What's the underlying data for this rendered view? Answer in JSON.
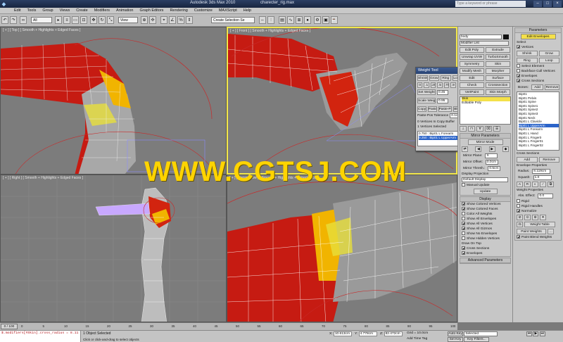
{
  "titlebar": {
    "app_title": "Autodesk 3ds Max 2010",
    "file_name": "charecter_rig.max",
    "search_placeholder": "Type a keyword or phrase"
  },
  "menu": [
    "Edit",
    "Tools",
    "Group",
    "Views",
    "Create",
    "Modifiers",
    "Animation",
    "Graph Editors",
    "Rendering",
    "Customize",
    "MAXScript",
    "Help"
  ],
  "toolbar": {
    "selection_filter": "All",
    "view_dropdown": "View",
    "selection_set": "Create Selection Se"
  },
  "viewports": {
    "top_label": "[ + ] [ Top ] [ Smooth + Highlights + Edged Faces ]",
    "front_label": "[ + ] [ Front ] [ Smooth + Highlights + Edged Faces ]",
    "right_label": "[ + ] [ Right ] [ Smooth + Highlights + Edged Faces ]",
    "persp_label": "[ + ] [ Perspective ] [ Smooth + Highlights + Edged Faces ]"
  },
  "watermark": "WWW.CGTSJ.COM",
  "weight_tool": {
    "title": "Weight Tool",
    "top_buttons": [
      "Shrink",
      "Grow",
      "Ring",
      "Loop"
    ],
    "preset_buttons": [
      "0",
      ".1",
      ".25",
      ".5",
      ".75",
      ".9",
      "1"
    ],
    "set_weight_label": "Set Weight",
    "set_weight_value": "0.45",
    "scale_weight_label": "Scale Weight",
    "scale_weight_value": "0.95",
    "copy_buttons": [
      "Copy",
      "Paste",
      "Paste-Pos",
      "Blend"
    ],
    "tolerance_label": "Paste-Pos Tolerance",
    "tolerance_value": "0.1cm",
    "copy_buffer_text": "0 Vertices In Copy Buffer",
    "selected_text": "1 Vertices Selected",
    "list_items": [
      "0.750 : Bip01 L Forearm",
      "0.250 : Bip01 L UpperArm"
    ]
  },
  "command_panel": {
    "object_name": "body",
    "modifier_list_label": "Modifier List",
    "modifier_buttons": [
      [
        "Edit Poly",
        "Extrude"
      ],
      [
        "Unwrap UVW",
        "TurboSmooth"
      ],
      [
        "Symmetry",
        "Skin"
      ],
      [
        "Modify Mesh",
        "Morpher"
      ],
      [
        "Edit",
        "Surface"
      ],
      [
        "Check",
        "Crosssection"
      ],
      [
        "VertPaint",
        "Skin Morph"
      ]
    ],
    "stack_items": [
      "Skin",
      "Editable Poly"
    ],
    "mirror_header": "Mirror Parameters",
    "mirror_mode": "Mirror Mode",
    "mirror_plane_label": "Mirror Plane:",
    "mirror_plane_value": "X",
    "mirror_offset_label": "Mirror Offset:",
    "mirror_offset_value": "0.0cm",
    "mirror_thresh_label": "Mirror Thresh.:",
    "mirror_thresh_value": "0.5cm",
    "display_projection_label": "Display Projection",
    "display_projection_value": "Default Display",
    "manual_update_label": "Manual Update",
    "update_label": "Update",
    "display_header": "Display",
    "display_options": [
      {
        "label": "Show Colored Vertices",
        "on": true
      },
      {
        "label": "Show Colored Faces",
        "on": true
      },
      {
        "label": "Color All Weights",
        "on": false
      },
      {
        "label": "Show All Envelopes",
        "on": false
      },
      {
        "label": "Show All Vertices",
        "on": true
      },
      {
        "label": "Show All Gizmos",
        "on": true
      },
      {
        "label": "Show No Envelopes",
        "on": false
      },
      {
        "label": "Show Hidden Vertices",
        "on": false
      }
    ],
    "draw_on_top_label": "Draw On Top",
    "draw_on_top_options": [
      {
        "label": "Cross Sections",
        "on": true
      },
      {
        "label": "Envelopes",
        "on": true
      }
    ],
    "advanced_header": "Advanced Parameters"
  },
  "right_panel": {
    "parameters_header": "Parameters",
    "edit_envelopes_label": "Edit Envelopes",
    "select_label": "Select",
    "vertices_label": "Vertices",
    "select_buttons": [
      [
        "Shrink",
        "Grow"
      ],
      [
        "Ring",
        "Loop"
      ]
    ],
    "select_options": [
      {
        "label": "Select Element",
        "on": false
      },
      {
        "label": "Backface Cull Vertices",
        "on": false
      },
      {
        "label": "Envelopes",
        "on": true
      },
      {
        "label": "Cross Sections",
        "on": true
      }
    ],
    "bones_label": "Bones:",
    "add_label": "Add",
    "remove_label": "Remove",
    "bones": [
      "Bip01",
      "Bip01 Pelvis",
      "Bip01 Spine",
      "Bip01 Spine1",
      "Bip01 Spine2",
      "Bip01 Spine3",
      "Bip01 Neck",
      "Bip01 L Clavicle",
      "Bip01 L UpperArm",
      "Bip01 L Forearm",
      "Bip01 L Hand",
      "Bip01 L Finger0",
      "Bip01 L Finger01",
      "Bip01 L Finger02"
    ],
    "selected_bone_index": 8,
    "cross_sections_label": "Cross Sections",
    "cs_add": "Add",
    "cs_remove": "Remove",
    "envelope_props_label": "Envelope Properties",
    "radius_label": "Radius:",
    "radius_value": "8.119cm",
    "squash_label": "Squash:",
    "squash_value": "1.0",
    "weight_props_label": "Weight Properties",
    "abs_effect_label": "Abs. Effect:",
    "abs_effect_value": "0.0",
    "weight_options": [
      {
        "label": "Rigid",
        "on": false
      },
      {
        "label": "Rigid Handles",
        "on": false
      },
      {
        "label": "Normalize",
        "on": true
      }
    ],
    "weight_table_label": "Weight Table",
    "paint_weights_label": "Paint Weights",
    "paint_blend_label": "Paint Blend Weights"
  },
  "timeline": {
    "slider": "0 / 100",
    "ticks": [
      "0",
      "5",
      "10",
      "15",
      "20",
      "25",
      "30",
      "35",
      "40",
      "45",
      "50",
      "55",
      "60",
      "65",
      "70",
      "75",
      "80",
      "85",
      "90",
      "95",
      "100"
    ]
  },
  "status": {
    "script": "$.modifiers[#Skin].cross_radius = 8.11",
    "objects_selected": "1 Object Selected",
    "prompt": "Click or click-and-drag to select objects",
    "x": "10.613cm",
    "y": "4.778cm",
    "z": "82.472cm",
    "grid": "Grid = 10.0cm",
    "add_time_tag": "Add Time Tag",
    "auto_key": "Auto Key",
    "set_key": "Set Key",
    "selected_dropdown": "Selected",
    "key_filters": "Key Filters..."
  }
}
